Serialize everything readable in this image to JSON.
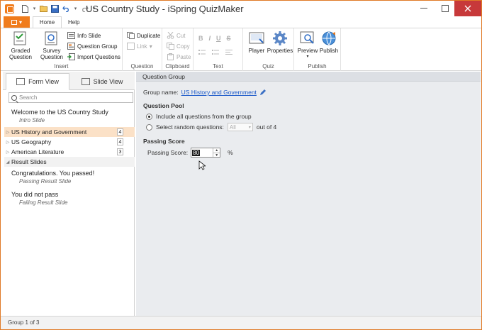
{
  "window": {
    "title": "US Country Study - iSpring QuizMaker",
    "accent": "#f07c1c"
  },
  "quick_access": [
    "new-icon",
    "open-icon",
    "save-icon",
    "undo-icon",
    "redo-icon"
  ],
  "ribbon": {
    "tabs": [
      "Home",
      "Help"
    ],
    "active_tab": "Home",
    "insert": {
      "label": "Insert",
      "graded": "Graded Question",
      "survey": "Survey Question",
      "info_slide": "Info Slide",
      "question_group": "Question Group",
      "import_questions": "Import Questions"
    },
    "question": {
      "label": "Question",
      "duplicate": "Duplicate",
      "link": "Link"
    },
    "clipboard": {
      "label": "Clipboard",
      "cut": "Cut",
      "copy": "Copy",
      "paste": "Paste"
    },
    "text": {
      "label": "Text",
      "bold": "B",
      "italic": "I",
      "underline": "U",
      "strike": "S"
    },
    "quiz": {
      "label": "Quiz",
      "player": "Player",
      "properties": "Properties"
    },
    "publish": {
      "label": "Publish",
      "preview": "Preview",
      "publish": "Publish"
    }
  },
  "left_pane": {
    "tabs": {
      "form_view": "Form View",
      "slide_view": "Slide View"
    },
    "search_placeholder": "Search",
    "intro": {
      "title": "Welcome to the US Country Study",
      "subtitle": "Intro Slide"
    },
    "groups": [
      {
        "label": "US History and Government",
        "count": "4",
        "selected": true
      },
      {
        "label": "US Geography",
        "count": "4",
        "selected": false
      },
      {
        "label": "American Literature",
        "count": "3",
        "selected": false
      }
    ],
    "result_header": "Result Slides",
    "results": [
      {
        "title": "Congratulations. You passed!",
        "subtitle": "Passing Result Slide"
      },
      {
        "title": "You did not pass",
        "subtitle": "Failing Result Slide"
      }
    ]
  },
  "right_pane": {
    "header": "Question Group",
    "group_name_label": "Group name:",
    "group_name_value": "US History and Government",
    "question_pool": {
      "title": "Question Pool",
      "include_all": "Include all questions from the group",
      "select_random": "Select random questions:",
      "random_value": "All",
      "out_of": "out of 4",
      "selected_option": "include_all"
    },
    "passing_score": {
      "title": "Passing Score",
      "label": "Passing Score:",
      "value": "80",
      "unit": "%"
    }
  },
  "statusbar": {
    "text": "Group 1 of 3"
  }
}
